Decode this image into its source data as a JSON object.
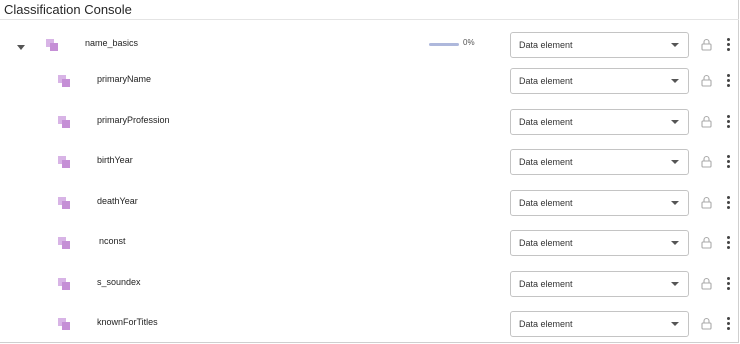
{
  "window": {
    "title": "Classification Console"
  },
  "parent_row": {
    "label": "name_basics",
    "progress_text": "0%",
    "progress": 0,
    "select_value": "Data element"
  },
  "child_rows": [
    {
      "label": "primaryName",
      "select_value": "Data element"
    },
    {
      "label": "primaryProfession",
      "select_value": "Data element"
    },
    {
      "label": "birthYear",
      "select_value": "Data element"
    },
    {
      "label": "deathYear",
      "select_value": "Data element"
    },
    {
      "label": "nconst",
      "select_value": "Data element"
    },
    {
      "label": "s_soundex",
      "select_value": "Data element"
    },
    {
      "label": "knownForTitles",
      "select_value": "Data element"
    }
  ],
  "icons": {
    "caret": "caret-down-icon",
    "asset": "data-asset-icon",
    "lock": "lock-icon",
    "menu": "more-vertical-icon"
  },
  "colors": {
    "asset_icon": "#c58fd6",
    "progress": "#aeb8dc"
  }
}
